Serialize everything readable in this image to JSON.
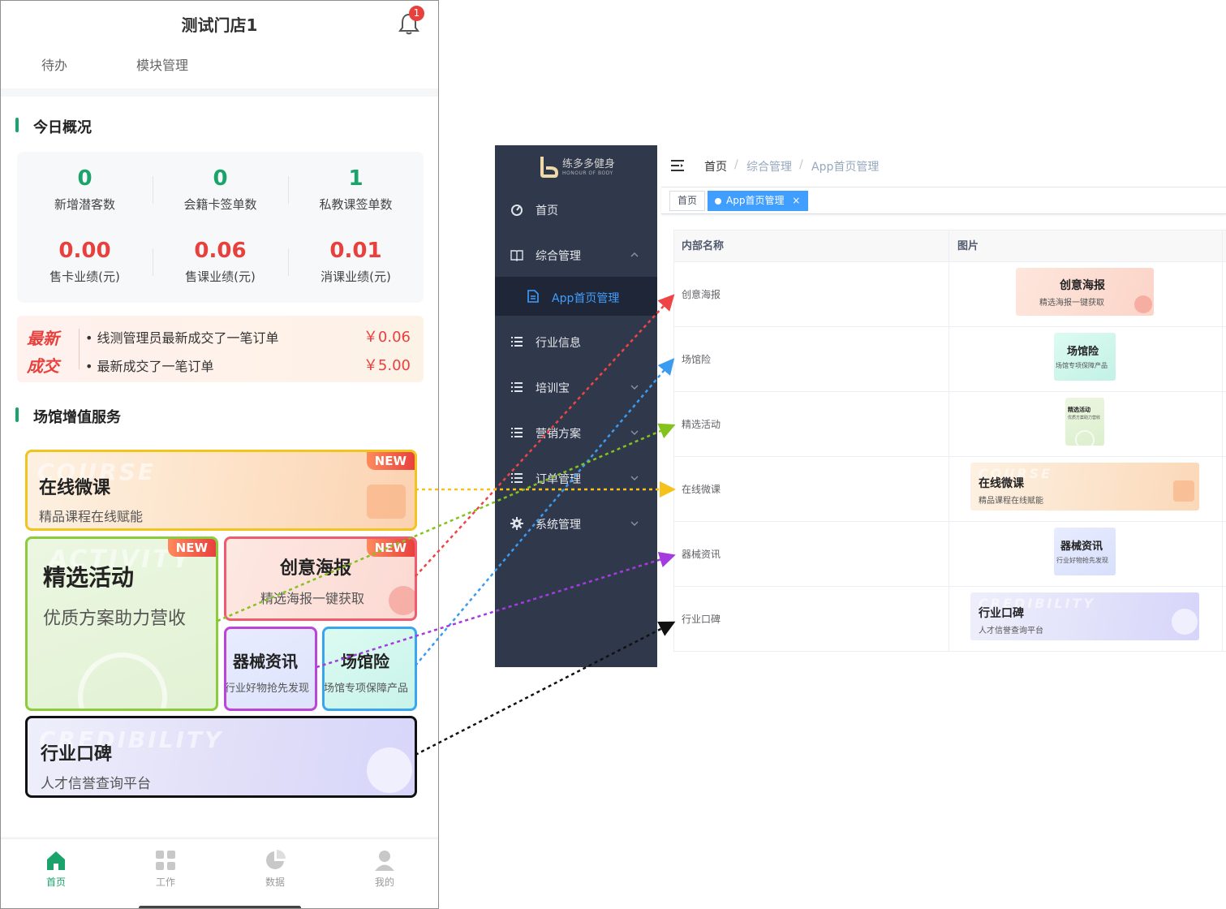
{
  "colors": {
    "accent_green": "#1aa36a",
    "stat_green": "#1aa36a",
    "stat_red": "#e8403d",
    "sidebar_bg": "#30394c",
    "admin_accent": "#409eff"
  },
  "mobile": {
    "store_title": "测试门店1",
    "notification_count": "1",
    "top_tabs": [
      "待办",
      "模块管理"
    ],
    "overview": {
      "title": "今日概况",
      "stats": [
        {
          "value": "0",
          "label": "新增潜客数"
        },
        {
          "value": "0",
          "label": "会籍卡签单数"
        },
        {
          "value": "1",
          "label": "私教课签单数"
        },
        {
          "value": "0.00",
          "label": "售卡业绩(元)"
        },
        {
          "value": "0.06",
          "label": "售课业绩(元)"
        },
        {
          "value": "0.01",
          "label": "消课业绩(元)"
        }
      ]
    },
    "latest_deals": {
      "tag_line1": "最新",
      "tag_line2": "成交",
      "items": [
        {
          "text": "• 线测管理员最新成交了一笔订单",
          "amount": "￥0.06"
        },
        {
          "text": "• 最新成交了一笔订单",
          "amount": "￥5.00"
        }
      ]
    },
    "services": {
      "title": "场馆增值服务",
      "new_label": "NEW",
      "cards": {
        "course": {
          "ghost": "COURSE",
          "title": "在线微课",
          "subtitle": "精品课程在线赋能"
        },
        "activity": {
          "ghost": "ACTIVITY",
          "title": "精选活动",
          "subtitle": "优质方案助力营收"
        },
        "poster": {
          "title": "创意海报",
          "subtitle": "精选海报一键获取"
        },
        "equipment": {
          "title": "器械资讯",
          "subtitle": "行业好物抢先发现"
        },
        "insurance": {
          "title": "场馆险",
          "subtitle": "场馆专项保障产品"
        },
        "credibility": {
          "ghost": "CREDIBILITY",
          "title": "行业口碑",
          "subtitle": "人才信誉查询平台"
        }
      }
    },
    "tabbar": [
      {
        "label": "首页",
        "icon": "home-icon",
        "active": true
      },
      {
        "label": "工作",
        "icon": "grid-icon",
        "active": false
      },
      {
        "label": "数据",
        "icon": "pie-chart-icon",
        "active": false
      },
      {
        "label": "我的",
        "icon": "user-icon",
        "active": false
      }
    ]
  },
  "admin": {
    "logo_cn": "练多多健身",
    "logo_en": "HONOUR OF BODY",
    "menu": [
      {
        "label": "首页",
        "icon": "dashboard-icon"
      },
      {
        "label": "综合管理",
        "icon": "book-icon"
      },
      {
        "label": "行业信息",
        "icon": "list-icon"
      },
      {
        "label": "培训宝",
        "icon": "list-icon"
      },
      {
        "label": "营销方案",
        "icon": "list-icon"
      },
      {
        "label": "订单管理",
        "icon": "list-icon"
      },
      {
        "label": "系统管理",
        "icon": "gear-icon"
      }
    ],
    "submenu_active": "App首页管理",
    "breadcrumb": [
      "首页",
      "/",
      "综合管理",
      "/",
      "App首页管理"
    ],
    "tags": [
      "首页",
      "App首页管理"
    ],
    "table": {
      "headers": [
        "内部名称",
        "图片"
      ],
      "rows": [
        {
          "name": "创意海报",
          "img_title": "创意海报",
          "img_sub": "精选海报一键获取"
        },
        {
          "name": "场馆险",
          "img_title": "场馆险",
          "img_sub": "场馆专项保障产品"
        },
        {
          "name": "精选活动",
          "img_title": "精选活动",
          "img_sub": "优质方案助力营收"
        },
        {
          "name": "在线微课",
          "img_title": "在线微课",
          "img_sub": "精品课程在线赋能",
          "img_ghost": "COURSE"
        },
        {
          "name": "器械资讯",
          "img_title": "器械资讯",
          "img_sub": "行业好物抢先发现"
        },
        {
          "name": "行业口碑",
          "img_title": "行业口碑",
          "img_sub": "人才信誉查询平台",
          "img_ghost": "CREDIBILITY"
        }
      ]
    }
  },
  "connectors": [
    {
      "from": "poster",
      "to": "创意海报",
      "color": "#ef4444"
    },
    {
      "from": "insurance",
      "to": "场馆险",
      "color": "#3b9bf0"
    },
    {
      "from": "activity",
      "to": "精选活动",
      "color": "#84c31e"
    },
    {
      "from": "course",
      "to": "在线微课",
      "color": "#f5c11a"
    },
    {
      "from": "equipment",
      "to": "器械资讯",
      "color": "#a43bdf"
    },
    {
      "from": "credibility",
      "to": "行业口碑",
      "color": "#111111"
    }
  ]
}
